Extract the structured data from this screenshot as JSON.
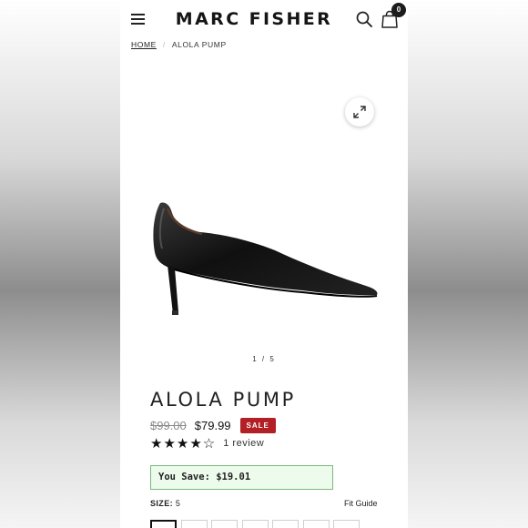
{
  "header": {
    "brand": "MARC FISHER",
    "cart_count": "0"
  },
  "breadcrumb": {
    "home": "HOME",
    "separator": "/",
    "current": "ALOLA PUMP"
  },
  "gallery": {
    "pager": "1 / 5",
    "image_count": 5,
    "current_index": 1
  },
  "product": {
    "title": "ALOLA PUMP",
    "original_price": "$99.00",
    "sale_price": "$79.99",
    "sale_label": "SALE",
    "rating": 4,
    "rating_max": 5,
    "stars": "★★★★☆",
    "reviews_label": "1 review",
    "savings_text": "You Save: $19.01",
    "size_label": "SIZE:",
    "size_value": "5",
    "fit_guide": "Fit Guide",
    "size_options_visible": 7
  },
  "colors": {
    "sale_badge": "#b21f24",
    "savings_bg": "#ecfbec",
    "savings_border": "#7bb97b"
  },
  "icons": [
    "menu-icon",
    "search-icon",
    "shopping-bag-icon",
    "expand-icon"
  ]
}
